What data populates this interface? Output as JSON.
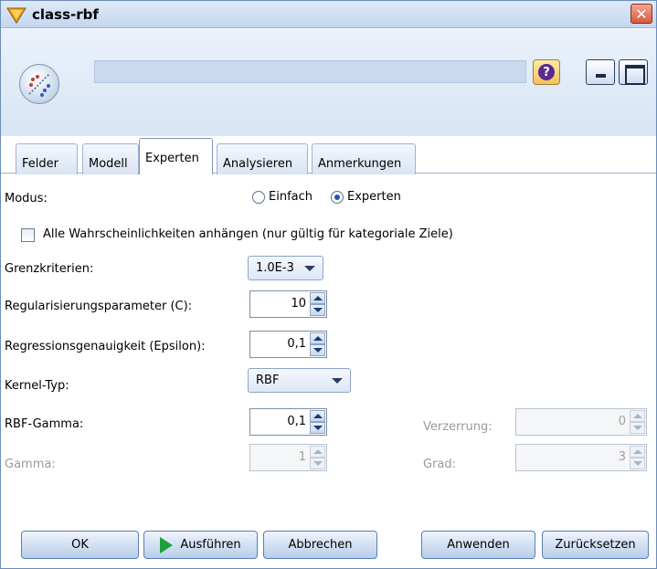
{
  "window": {
    "title": "class-rbf",
    "close_glyph": "✕"
  },
  "header": {
    "help_glyph": "?"
  },
  "tabs": [
    {
      "label": "Felder"
    },
    {
      "label": "Modell"
    },
    {
      "label": "Experten"
    },
    {
      "label": "Analysieren"
    },
    {
      "label": "Anmerkungen"
    }
  ],
  "form": {
    "mode_label": "Modus:",
    "mode_simple": "Einfach",
    "mode_expert": "Experten",
    "mode_selected": "Experten",
    "append_probs_label": "Alle Wahrscheinlichkeiten anhängen (nur gültig für kategoriale Ziele)",
    "append_probs_checked": false,
    "stop_label": "Grenzkriterien:",
    "stop_value": "1.0E-3",
    "reg_label": "Regularisierungsparameter (C):",
    "reg_value": "10",
    "eps_label": "Regressionsgenauigkeit (Epsilon):",
    "eps_value": "0,1",
    "kernel_label": "Kernel-Typ:",
    "kernel_value": "RBF",
    "rbf_gamma_label": "RBF-Gamma:",
    "rbf_gamma_value": "0,1",
    "bias_label": "Verzerrung:",
    "bias_value": "0",
    "gamma_label": "Gamma:",
    "gamma_value": "1",
    "degree_label": "Grad:",
    "degree_value": "3"
  },
  "buttons": {
    "ok": "OK",
    "run": "Ausführen",
    "cancel": "Abbrechen",
    "apply": "Anwenden",
    "reset": "Zurücksetzen"
  }
}
